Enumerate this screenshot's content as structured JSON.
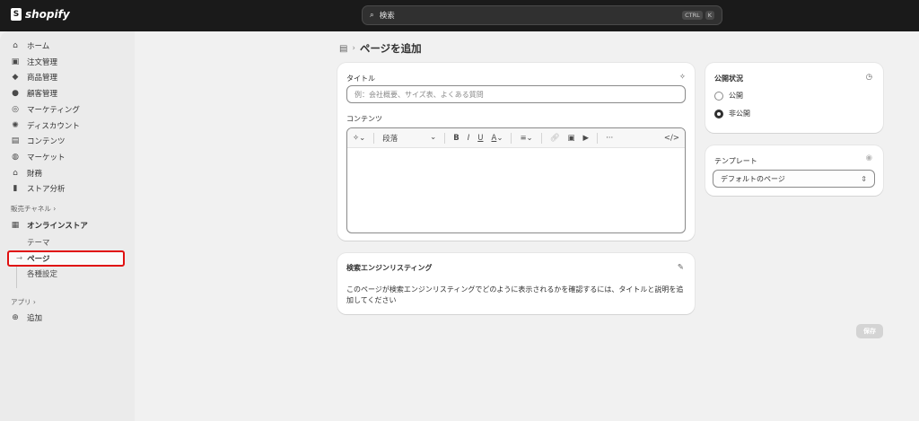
{
  "topbar": {
    "brand": "shopify",
    "search_placeholder": "検索",
    "shortcut": [
      "CTRL",
      "K"
    ]
  },
  "sidebar": {
    "items": [
      {
        "icon": "home-icon",
        "glyph": "⌂",
        "label": "ホーム"
      },
      {
        "icon": "inbox-icon",
        "glyph": "▣",
        "label": "注文管理"
      },
      {
        "icon": "tag-icon",
        "glyph": "◆",
        "label": "商品管理"
      },
      {
        "icon": "person-icon",
        "glyph": "●",
        "label": "顧客管理"
      },
      {
        "icon": "target-icon",
        "glyph": "◎",
        "label": "マーケティング"
      },
      {
        "icon": "discount-icon",
        "glyph": "✺",
        "label": "ディスカウント"
      },
      {
        "icon": "content-icon",
        "glyph": "▤",
        "label": "コンテンツ"
      },
      {
        "icon": "globe-icon",
        "glyph": "◍",
        "label": "マーケット"
      },
      {
        "icon": "bank-icon",
        "glyph": "⌂",
        "label": "財務"
      },
      {
        "icon": "bar-chart-icon",
        "glyph": "▮",
        "label": "ストア分析"
      }
    ],
    "sales_channels": "販売チャネル ›",
    "online_store": "オンラインストア",
    "theme": "テーマ",
    "pages": "ページ",
    "settings": "各種設定",
    "apps": "アプリ ›",
    "add": "追加"
  },
  "page": {
    "title": "ページを追加"
  },
  "editor": {
    "title_label": "タイトル",
    "title_placeholder": "例：会社概要、サイズ表、よくある質問",
    "content_label": "コンテンツ",
    "paragraph": "段落"
  },
  "seo": {
    "title": "検索エンジンリスティング",
    "description": "このページが検索エンジンリスティングでどのように表示されるかを確認するには、タイトルと説明を追加してください"
  },
  "visibility": {
    "title": "公開状況",
    "options": [
      "公開",
      "非公開"
    ],
    "selected": "非公開"
  },
  "template": {
    "title": "テンプレート",
    "value": "デフォルトのページ"
  },
  "save_label": "保存"
}
